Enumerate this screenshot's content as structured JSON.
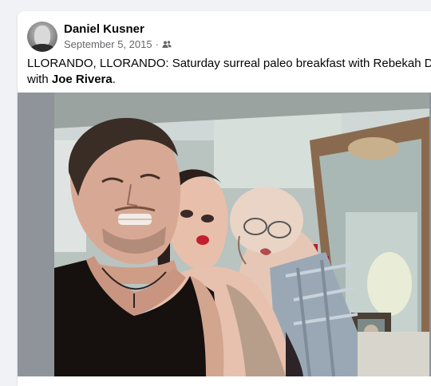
{
  "post": {
    "author": "Daniel Kusner",
    "date": "September 5, 2015",
    "separator": "·",
    "audience_icon": "friends-icon",
    "text_main": "LLORANDO, LLORANDO: Saturday surreal paleo breakfast with Rebekah Del Rio",
    "text_with": "with",
    "tagged": "Joe Rivera",
    "text_end": "."
  },
  "photo": {
    "subject": "selfie-photo"
  }
}
